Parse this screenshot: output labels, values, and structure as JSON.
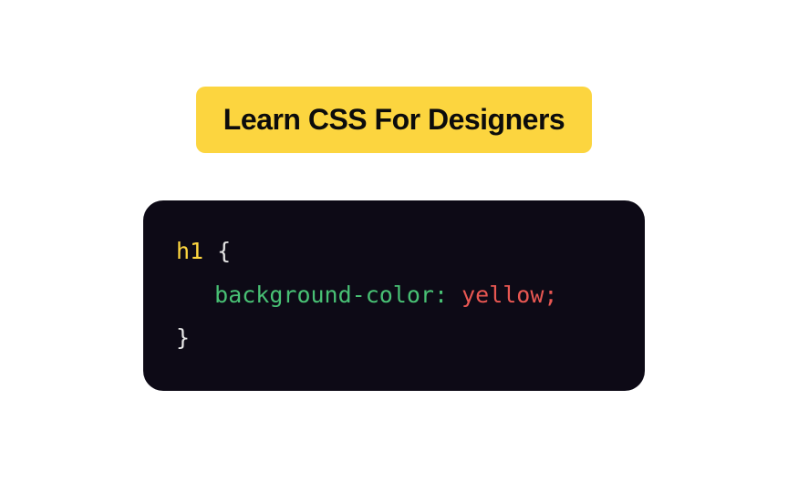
{
  "heading": "Learn CSS For Designers",
  "code": {
    "selector": "h1",
    "open_brace": "{",
    "property": "background-color",
    "colon": ":",
    "value": "yellow",
    "semicolon": ";",
    "close_brace": "}"
  }
}
